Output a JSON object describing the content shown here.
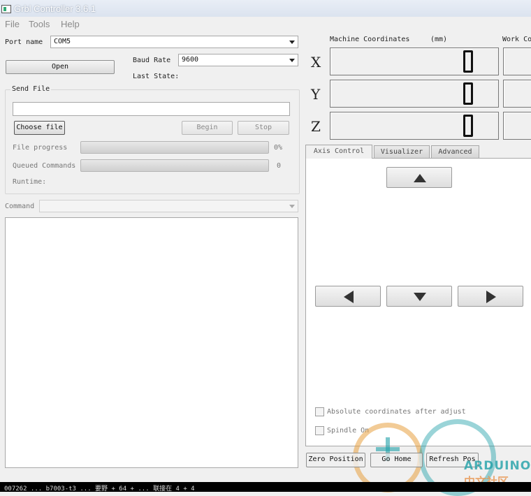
{
  "window": {
    "title": "Grbl Controller 3.6.1"
  },
  "menu": {
    "file": "File",
    "tools": "Tools",
    "help": "Help"
  },
  "connection": {
    "port_label": "Port name",
    "port_value": "COM5",
    "baud_label": "Baud Rate",
    "baud_value": "9600",
    "open_label": "Open",
    "last_state_label": "Last State:"
  },
  "send_file": {
    "group_title": "Send File",
    "file_path": "",
    "choose_label": "Choose file",
    "begin_label": "Begin",
    "stop_label": "Stop",
    "file_progress_label": "File progress",
    "file_progress_value": "0%",
    "file_progress_fraction": 0,
    "queued_label": "Queued Commands",
    "queued_value": "0",
    "runtime_label": "Runtime:"
  },
  "command": {
    "label": "Command",
    "value": ""
  },
  "coordinates": {
    "machine_label": "Machine Coordinates",
    "unit_label": "(mm)",
    "work_label": "Work Co",
    "axes": [
      {
        "axis": "X",
        "machine": "0"
      },
      {
        "axis": "Y",
        "machine": "0"
      },
      {
        "axis": "Z",
        "machine": "0"
      }
    ]
  },
  "tabs": {
    "axis_control": "Axis Control",
    "visualizer": "Visualizer",
    "advanced": "Advanced",
    "active": "Axis Control"
  },
  "jog": {
    "up_icon": "arrow-up-icon",
    "down_icon": "arrow-down-icon",
    "left_icon": "arrow-left-icon",
    "right_icon": "arrow-right-icon"
  },
  "options": {
    "absolute_label": "Absolute coordinates after adjust",
    "absolute_checked": false,
    "spindle_label": "Spindle On",
    "spindle_checked": false
  },
  "bottom_buttons": {
    "zero_position": "Zero Position",
    "go_home": "Go Home",
    "refresh_pos": "Refresh Pos"
  },
  "watermark": {
    "brand": "ARDUINO",
    "subtitle": "中文社区"
  },
  "statusbar": {
    "text": "007262 ... b7003-t3 ... 要野 + 64 + ... 联接在 4 + 4"
  },
  "colors": {
    "lcd_digit": "#111111",
    "watermark_teal": "#20a0a8",
    "watermark_orange": "#e8a040"
  }
}
